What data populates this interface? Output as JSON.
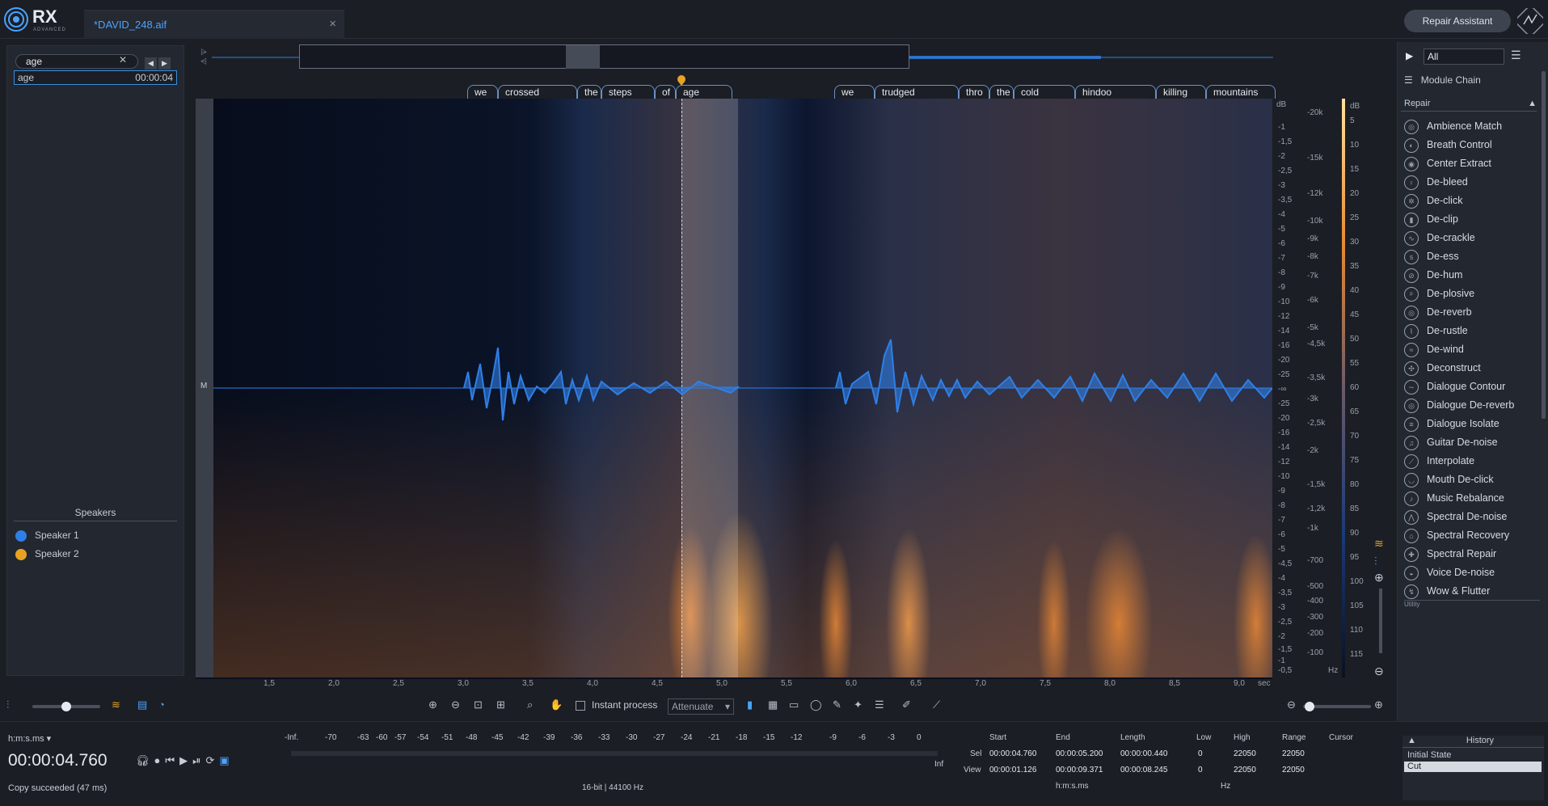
{
  "app": {
    "name": "RX",
    "edition": "ADVANCED",
    "repair_assistant": "Repair Assistant"
  },
  "file": {
    "tab_name": "*DAVID_248.aif"
  },
  "search": {
    "query": "age",
    "result_word": "age",
    "result_time": "00:00:04"
  },
  "speakers": {
    "title": "Speakers",
    "items": [
      {
        "label": "Speaker 1",
        "color": "#2f7fe6"
      },
      {
        "label": "Speaker 2",
        "color": "#e9a323"
      }
    ]
  },
  "channel_label": "M",
  "words": [
    {
      "text": "we"
    },
    {
      "text": "crossed"
    },
    {
      "text": "the"
    },
    {
      "text": "steps"
    },
    {
      "text": "of"
    },
    {
      "text": "age"
    },
    {
      "text": "we"
    },
    {
      "text": "trudged"
    },
    {
      "text": "thro"
    },
    {
      "text": "the"
    },
    {
      "text": "cold"
    },
    {
      "text": "hindoo"
    },
    {
      "text": "killing"
    },
    {
      "text": "mountains"
    }
  ],
  "db_scale": [
    "dB",
    "-1",
    "-1,5",
    "-2",
    "-2,5",
    "-3",
    "-3,5",
    "-4",
    "-5",
    "-6",
    "-7",
    "-8",
    "-9",
    "-10",
    "-12",
    "-14",
    "-16",
    "-20",
    "-25",
    "-∞",
    "-25",
    "-20",
    "-16",
    "-14",
    "-12",
    "-10",
    "-9",
    "-8",
    "-7",
    "-6",
    "-5",
    "-4,5",
    "-4",
    "-3,5",
    "-3",
    "-2,5",
    "-2",
    "-1,5",
    "-1",
    "-0,5"
  ],
  "hz_scale": [
    "-20k",
    "-15k",
    "-12k",
    "-10k",
    "-9k",
    "-8k",
    "-7k",
    "-6k",
    "-5k",
    "-4,5k",
    "-3,5k",
    "-3k",
    "-2,5k",
    "-2k",
    "-1,5k",
    "-1,2k",
    "-1k",
    "-700",
    "-500",
    "-400",
    "-300",
    "-200",
    "-100",
    "Hz"
  ],
  "color_scale": [
    "dB",
    "5",
    "10",
    "15",
    "20",
    "25",
    "30",
    "35",
    "40",
    "45",
    "50",
    "55",
    "60",
    "65",
    "70",
    "75",
    "80",
    "85",
    "90",
    "95",
    "100",
    "105",
    "110",
    "115"
  ],
  "time_axis": [
    "1,5",
    "2,0",
    "2,5",
    "3,0",
    "3,5",
    "4,0",
    "4,5",
    "5,0",
    "5,5",
    "6,0",
    "6,5",
    "7,0",
    "7,5",
    "8,0",
    "8,5",
    "9,0",
    "sec"
  ],
  "modules": {
    "filter": "All",
    "chain": "Module Chain",
    "section": "Repair",
    "items": [
      "Ambience Match",
      "Breath Control",
      "Center Extract",
      "De-bleed",
      "De-click",
      "De-clip",
      "De-crackle",
      "De-ess",
      "De-hum",
      "De-plosive",
      "De-reverb",
      "De-rustle",
      "De-wind",
      "Deconstruct",
      "Dialogue Contour",
      "Dialogue De-reverb",
      "Dialogue Isolate",
      "Guitar De-noise",
      "Interpolate",
      "Mouth De-click",
      "Music Rebalance",
      "Spectral De-noise",
      "Spectral Recovery",
      "Spectral Repair",
      "Voice De-noise",
      "Wow & Flutter"
    ],
    "next_section": "Utility"
  },
  "toolbar": {
    "instant_process": "Instant process",
    "attenuate": "Attenuate"
  },
  "transport": {
    "time_format": "h:m:s.ms",
    "timecode": "00:00:04.760",
    "status": "Copy succeeded (47 ms)"
  },
  "meter": {
    "ticks": [
      "-Inf.",
      "-70",
      "-63",
      "-60",
      "-57",
      "-54",
      "-51",
      "-48",
      "-45",
      "-42",
      "-39",
      "-36",
      "-33",
      "-30",
      "-27",
      "-24",
      "-21",
      "-18",
      "-15",
      "-12",
      "-9",
      "-6",
      "-3",
      "0"
    ],
    "right": "-Inf",
    "format": "16-bit | 44100 Hz"
  },
  "selection": {
    "start_label": "Start",
    "end_label": "End",
    "length_label": "Length",
    "low_label": "Low",
    "high_label": "High",
    "range_label": "Range",
    "cursor_label": "Cursor",
    "sel_label": "Sel",
    "view_label": "View",
    "sel_start": "00:00:04.760",
    "sel_end": "00:00:05.200",
    "sel_length": "00:00:00.440",
    "sel_low": "0",
    "sel_high": "22050",
    "sel_range": "22050",
    "view_start": "00:00:01.126",
    "view_end": "00:00:09.371",
    "view_length": "00:00:08.245",
    "view_low": "0",
    "view_high": "22050",
    "view_range": "22050",
    "time_unit": "h:m:s.ms",
    "freq_unit": "Hz"
  },
  "history": {
    "title": "History",
    "items": [
      "Initial State",
      "Cut"
    ]
  }
}
